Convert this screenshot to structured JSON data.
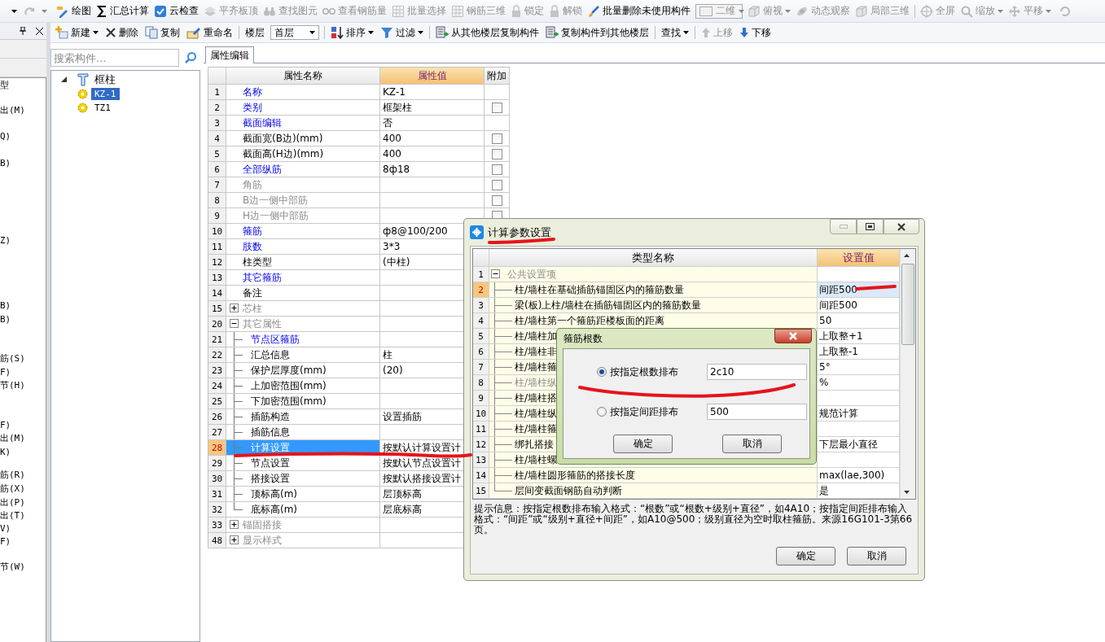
{
  "toolbar_main": {
    "items": [
      {
        "kind": "button",
        "label": "绘图",
        "disabled": false,
        "dropdown": false
      },
      {
        "kind": "button",
        "label": "汇总计算",
        "disabled": false,
        "dropdown": false
      },
      {
        "kind": "button",
        "label": "云检查",
        "disabled": false,
        "dropdown": false
      },
      {
        "kind": "button",
        "label": "平齐板顶",
        "disabled": true,
        "dropdown": false
      },
      {
        "kind": "button",
        "label": "查找图元",
        "disabled": true,
        "dropdown": false
      },
      {
        "kind": "button",
        "label": "查看钢筋量",
        "disabled": true,
        "dropdown": false
      },
      {
        "kind": "button",
        "label": "批量选择",
        "disabled": true,
        "dropdown": false
      },
      {
        "kind": "button",
        "label": "钢筋三维",
        "disabled": true,
        "dropdown": false
      },
      {
        "kind": "button",
        "label": "锁定",
        "disabled": true,
        "dropdown": false
      },
      {
        "kind": "button",
        "label": "解锁",
        "disabled": true,
        "dropdown": false
      },
      {
        "kind": "button",
        "label": "批量删除未使用构件",
        "disabled": false,
        "dropdown": false
      },
      {
        "kind": "combo",
        "label": "二维",
        "disabled": true,
        "dropdown": true
      },
      {
        "kind": "button",
        "label": "俯视",
        "disabled": true,
        "dropdown": true
      },
      {
        "kind": "button",
        "label": "动态观察",
        "disabled": true,
        "dropdown": false
      },
      {
        "kind": "button",
        "label": "局部三维",
        "disabled": true,
        "dropdown": false
      },
      {
        "kind": "separator"
      },
      {
        "kind": "button",
        "label": "全屏",
        "disabled": true,
        "dropdown": false
      },
      {
        "kind": "button",
        "label": "缩放",
        "disabled": true,
        "dropdown": true
      },
      {
        "kind": "button",
        "label": "平移",
        "disabled": true,
        "dropdown": true
      }
    ]
  },
  "side_strip": {
    "entries": [
      "型",
      "出(M)",
      "Q)",
      "B)",
      "Z)",
      "B)",
      "B)",
      "筋(S)",
      "F)",
      "节(H)",
      "F)",
      "出(M)",
      "K)",
      "筋(R)",
      "筋(X)",
      "出(P)",
      "出(T)",
      "V)",
      "F)",
      "节(W)"
    ]
  },
  "toolbar_components": {
    "items": [
      {
        "kind": "button",
        "label": "新建",
        "disabled": false,
        "dropdown": true
      },
      {
        "kind": "button",
        "label": "删除",
        "disabled": false,
        "dropdown": false
      },
      {
        "kind": "button",
        "label": "复制",
        "disabled": false,
        "dropdown": false
      },
      {
        "kind": "button",
        "label": "重命名",
        "disabled": false,
        "dropdown": false
      },
      {
        "kind": "separator"
      },
      {
        "kind": "label",
        "label": "楼层"
      },
      {
        "kind": "combo",
        "label": "首层",
        "disabled": false,
        "dropdown": true
      },
      {
        "kind": "separator"
      },
      {
        "kind": "button",
        "label": "排序",
        "disabled": false,
        "dropdown": true
      },
      {
        "kind": "button",
        "label": "过滤",
        "disabled": false,
        "dropdown": true
      },
      {
        "kind": "separator"
      },
      {
        "kind": "button",
        "label": "从其他楼层复制构件",
        "disabled": false,
        "dropdown": false
      },
      {
        "kind": "button",
        "label": "复制构件到其他楼层",
        "disabled": false,
        "dropdown": false
      },
      {
        "kind": "separator"
      },
      {
        "kind": "button",
        "label": "查找",
        "disabled": false,
        "dropdown": true
      },
      {
        "kind": "separator"
      },
      {
        "kind": "button",
        "label": "上移",
        "disabled": true,
        "dropdown": false
      },
      {
        "kind": "button",
        "label": "下移",
        "disabled": false,
        "dropdown": false
      }
    ]
  },
  "component_tree": {
    "search": {
      "placeholder": "搜索构件..."
    },
    "nodes": [
      {
        "label": "框柱",
        "expanded": true,
        "selected": false,
        "children": [
          {
            "label": "KZ-1",
            "selected": true
          },
          {
            "label": "TZ1",
            "selected": false
          }
        ]
      }
    ]
  },
  "properties": {
    "tab": {
      "label": "属性编辑",
      "selected": true
    },
    "columns": [
      "属性名称",
      "属性值",
      "附加"
    ],
    "rows": [
      {
        "num": "1",
        "name": "名称",
        "value": "KZ-1",
        "kind": "link",
        "has_checkbox": false,
        "selected": false
      },
      {
        "num": "2",
        "name": "类别",
        "value": "框架柱",
        "kind": "link",
        "has_checkbox": true,
        "checked": false,
        "selected": false
      },
      {
        "num": "3",
        "name": "截面编辑",
        "value": "否",
        "kind": "link",
        "has_checkbox": false,
        "selected": false
      },
      {
        "num": "4",
        "name": "截面宽(B边)(mm)",
        "value": "400",
        "kind": "normal",
        "has_checkbox": true,
        "checked": false,
        "selected": false
      },
      {
        "num": "5",
        "name": "截面高(H边)(mm)",
        "value": "400",
        "kind": "normal",
        "has_checkbox": true,
        "checked": false,
        "selected": false
      },
      {
        "num": "6",
        "name": "全部纵筋",
        "value": "8ф18",
        "kind": "link",
        "has_checkbox": true,
        "checked": false,
        "selected": false
      },
      {
        "num": "7",
        "name": "角筋",
        "kind": "disabled",
        "has_checkbox": true,
        "checked": false,
        "selected": false
      },
      {
        "num": "8",
        "name": "B边一侧中部筋",
        "kind": "disabled",
        "has_checkbox": true,
        "checked": false,
        "selected": false
      },
      {
        "num": "9",
        "name": "H边一侧中部筋",
        "kind": "disabled",
        "has_checkbox": true,
        "checked": false,
        "selected": false
      },
      {
        "num": "10",
        "name": "箍筋",
        "value": "ф8@100/200",
        "kind": "link",
        "selected": false
      },
      {
        "num": "11",
        "name": "肢数",
        "value": "3*3",
        "kind": "link",
        "selected": false
      },
      {
        "num": "12",
        "name": "柱类型",
        "value": "(中柱)",
        "kind": "normal",
        "selected": false
      },
      {
        "num": "13",
        "name": "其它箍筋",
        "kind": "link",
        "selected": false
      },
      {
        "num": "14",
        "name": "备注",
        "kind": "normal",
        "selected": false
      },
      {
        "num": "15",
        "name": "芯柱",
        "kind": "group",
        "expanded": false,
        "selected": false
      },
      {
        "num": "20",
        "name": "其它属性",
        "kind": "group",
        "expanded": true,
        "selected": false,
        "children": [
          {
            "num": "21",
            "name": "节点区箍筋",
            "kind": "link",
            "selected": false
          },
          {
            "num": "22",
            "name": "汇总信息",
            "value": "柱",
            "kind": "normal",
            "selected": false
          },
          {
            "num": "23",
            "name": "保护层厚度(mm)",
            "value": "(20)",
            "kind": "normal",
            "selected": false
          },
          {
            "num": "24",
            "name": "上加密范围(mm)",
            "kind": "normal",
            "selected": false
          },
          {
            "num": "25",
            "name": "下加密范围(mm)",
            "kind": "normal",
            "selected": false
          },
          {
            "num": "26",
            "name": "插筋构造",
            "value": "设置插筋",
            "kind": "normal",
            "selected": false
          },
          {
            "num": "27",
            "name": "插筋信息",
            "kind": "normal",
            "selected": false
          },
          {
            "num": "28",
            "name": "计算设置",
            "value": "按默认计算设置计",
            "kind": "normal",
            "selected": true
          },
          {
            "num": "29",
            "name": "节点设置",
            "value": "按默认节点设置计",
            "kind": "normal",
            "selected": false
          },
          {
            "num": "30",
            "name": "搭接设置",
            "value": "按默认搭接设置计",
            "kind": "normal",
            "selected": false
          },
          {
            "num": "31",
            "name": "顶标高(m)",
            "value": "层顶标高",
            "kind": "normal",
            "selected": false
          },
          {
            "num": "32",
            "name": "底标高(m)",
            "value": "层底标高",
            "kind": "normal",
            "selected": false
          }
        ]
      },
      {
        "num": "33",
        "name": "锚固搭接",
        "kind": "group",
        "expanded": false,
        "selected": false
      },
      {
        "num": "48",
        "name": "显示样式",
        "kind": "group",
        "expanded": false,
        "selected": false
      }
    ]
  },
  "calc_dialog": {
    "title": "计算参数设置",
    "columns": [
      "类型名称",
      "设置值"
    ],
    "rows": [
      {
        "num": "1",
        "name": "公共设置项",
        "kind": "group",
        "expanded": true,
        "selected": false,
        "children": [
          {
            "num": "2",
            "name": "柱/墙柱在基础插筋锚固区内的箍筋数量",
            "value": "间距500",
            "kind": "normal",
            "selected": true
          },
          {
            "num": "3",
            "name": "梁(板)上柱/墙柱在插筋锚固区内的箍筋数量",
            "value": "间距500",
            "kind": "normal",
            "selected": false
          },
          {
            "num": "4",
            "name": "柱/墙柱第一个箍筋距楼板面的距离",
            "value": "50",
            "kind": "normal",
            "selected": false
          },
          {
            "num": "5",
            "name": "柱/墙柱加",
            "value": "上取整+1",
            "kind": "normal",
            "selected": false
          },
          {
            "num": "6",
            "name": "柱/墙柱非",
            "value": "上取整-1",
            "kind": "normal",
            "selected": false
          },
          {
            "num": "7",
            "name": "柱/墙柱箍",
            "value": "5°",
            "kind": "normal",
            "selected": false
          },
          {
            "num": "8",
            "name": "柱/墙柱纵",
            "value": "%",
            "kind": "disabled",
            "selected": false
          },
          {
            "num": "9",
            "name": "柱/墙柱搭",
            "kind": "normal",
            "selected": false
          },
          {
            "num": "10",
            "name": "柱/墙柱纵",
            "value": "规范计算",
            "kind": "normal",
            "selected": false
          },
          {
            "num": "11",
            "name": "柱/墙柱箍",
            "kind": "normal",
            "selected": false
          },
          {
            "num": "12",
            "name": "绑扎搭接",
            "value": "下层最小直径",
            "kind": "normal",
            "selected": false
          },
          {
            "num": "13",
            "name": "柱/墙柱螺",
            "kind": "normal",
            "selected": false
          },
          {
            "num": "14",
            "name": "柱/墙柱圆形箍筋的搭接长度",
            "value": "max(lae,300)",
            "kind": "normal",
            "selected": false
          },
          {
            "num": "15",
            "name": "层间变截面钢筋自动判断",
            "value": "是",
            "kind": "normal",
            "selected": false
          }
        ]
      }
    ],
    "hint": "提示信息：按指定根数排布输入格式：“根数”或“根数+级别+直径”，如4A10；按指定间距排布输入格式：“间距”或“级别+直径+间距”，如A10@500；级别直径为空时取柱箍筋。来源16G101-3第66页。",
    "buttons": [
      "确定",
      "取消"
    ]
  },
  "count_dialog": {
    "title": "箍筋根数",
    "options": [
      {
        "label": "按指定根数排布",
        "selected": true,
        "value": "2c10"
      },
      {
        "label": "按指定间距排布",
        "selected": false,
        "value": "500"
      }
    ],
    "buttons": [
      "确定",
      "取消"
    ]
  }
}
